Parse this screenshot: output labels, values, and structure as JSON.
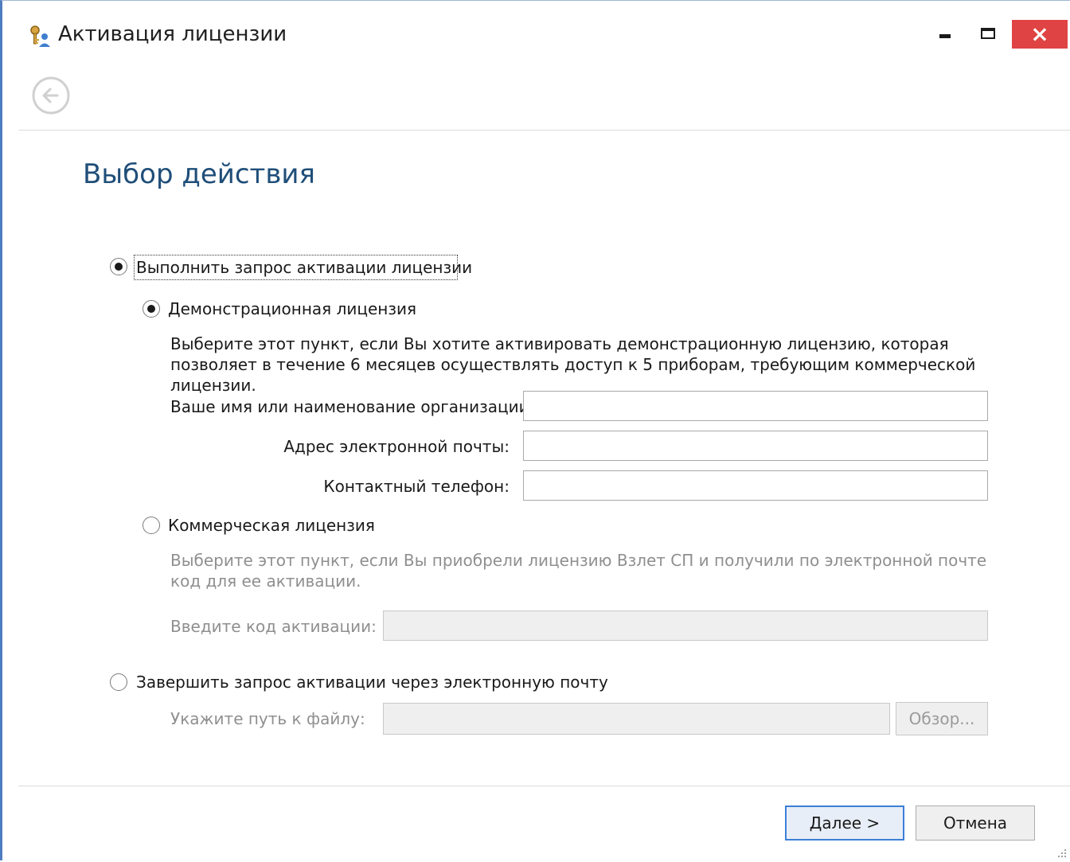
{
  "window": {
    "title": "Активация лицензии",
    "close_symbol": "×",
    "accent_close": "#e04343"
  },
  "icons": {
    "app": "key-people-icon",
    "back": "back-arrow-icon",
    "minimize": "minimize-icon",
    "maximize": "maximize-icon",
    "close": "close-icon"
  },
  "page": {
    "title": "Выбор действия"
  },
  "option_request": {
    "label": "Выполнить запрос активации лицензии",
    "checked": true
  },
  "option_demo": {
    "label": "Демонстрационная лицензия",
    "checked": true,
    "description_line1": "Выберите этот пункт, если Вы хотите активировать демонстрационную лицензию, которая",
    "description_line2": "позволяет в течение 6 месяцев осуществлять доступ к 5 приборам, требующим коммерческой",
    "description_line3": "лицензии.",
    "name_label": "Ваше имя или наименование организации:",
    "name_value": "",
    "email_label": "Адрес электронной почты:",
    "email_value": "",
    "phone_label": "Контактный телефон:",
    "phone_value": ""
  },
  "option_commercial": {
    "label": "Коммерческая лицензия",
    "checked": false,
    "description_line1": "Выберите этот пункт, если Вы приобрели лицензию Взлет СП и получили по электронной почте",
    "description_line2": "код для ее активации.",
    "code_label": "Введите код активации:",
    "code_value": ""
  },
  "option_finish": {
    "label": "Завершить запрос активации через электронную почту",
    "checked": false,
    "path_label": "Укажите путь к файлу:",
    "path_value": "",
    "browse_label": "Обзор..."
  },
  "footer": {
    "next_mnemonic": "Д",
    "next_rest": "алее >",
    "cancel_label": "Отмена"
  }
}
